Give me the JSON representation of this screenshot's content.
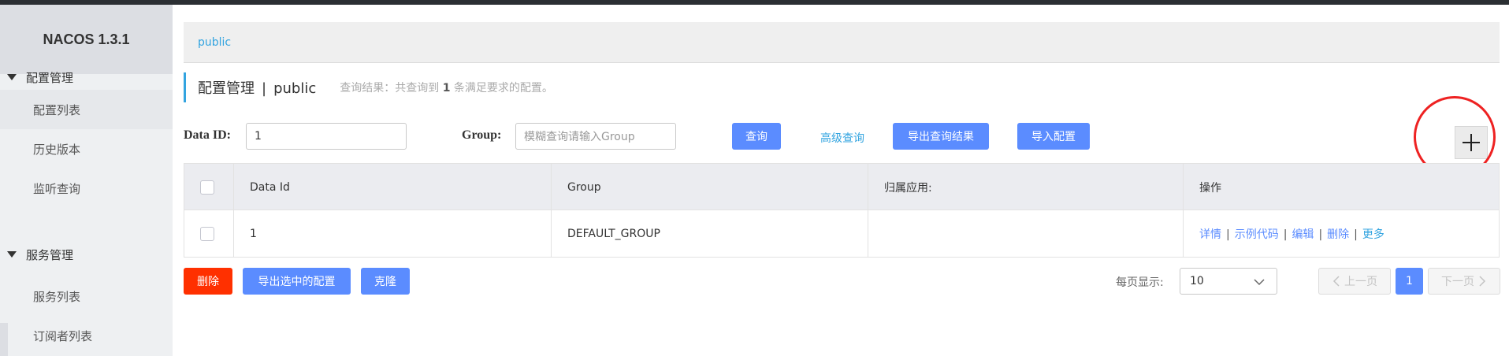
{
  "app": {
    "logo": "NACOS 1.3.1"
  },
  "sidebar": {
    "groups": [
      {
        "label": "配置管理",
        "items": [
          {
            "label": "配置列表"
          },
          {
            "label": "历史版本"
          },
          {
            "label": "监听查询"
          }
        ]
      },
      {
        "label": "服务管理",
        "items": [
          {
            "label": "服务列表"
          },
          {
            "label": "订阅者列表"
          }
        ]
      }
    ]
  },
  "namespace": {
    "current": "public"
  },
  "page": {
    "title": "配置管理",
    "separator": "|",
    "namespace": "public",
    "query_hint_prefix": "查询结果：共查询到",
    "query_hint_count": "1",
    "query_hint_suffix": "条满足要求的配置。"
  },
  "search": {
    "data_id_label": "Data ID:",
    "data_id_value": "1",
    "group_label": "Group:",
    "group_placeholder": "模糊查询请输入Group",
    "query_button": "查询",
    "advanced_query": "高级查询",
    "export_results_button": "导出查询结果",
    "import_button": "导入配置"
  },
  "add_button": {
    "icon": "plus-icon"
  },
  "table": {
    "columns": [
      "Data Id",
      "Group",
      "归属应用:",
      "操作"
    ],
    "rows": [
      {
        "data_id": "1",
        "group": "DEFAULT_GROUP",
        "app": ""
      }
    ],
    "row_actions": [
      "详情",
      "示例代码",
      "编辑",
      "删除",
      "更多"
    ]
  },
  "footer": {
    "delete_button": "删除",
    "export_selected_button": "导出选中的配置",
    "clone_button": "克隆",
    "page_size_label": "每页显示:",
    "page_size": "10",
    "prev": "上一页",
    "current_page": "1",
    "next": "下一页"
  },
  "colors": {
    "primary": "#5b8cff",
    "danger": "#ff3000",
    "link": "#33a4e0",
    "annotation": "#ee2222"
  }
}
